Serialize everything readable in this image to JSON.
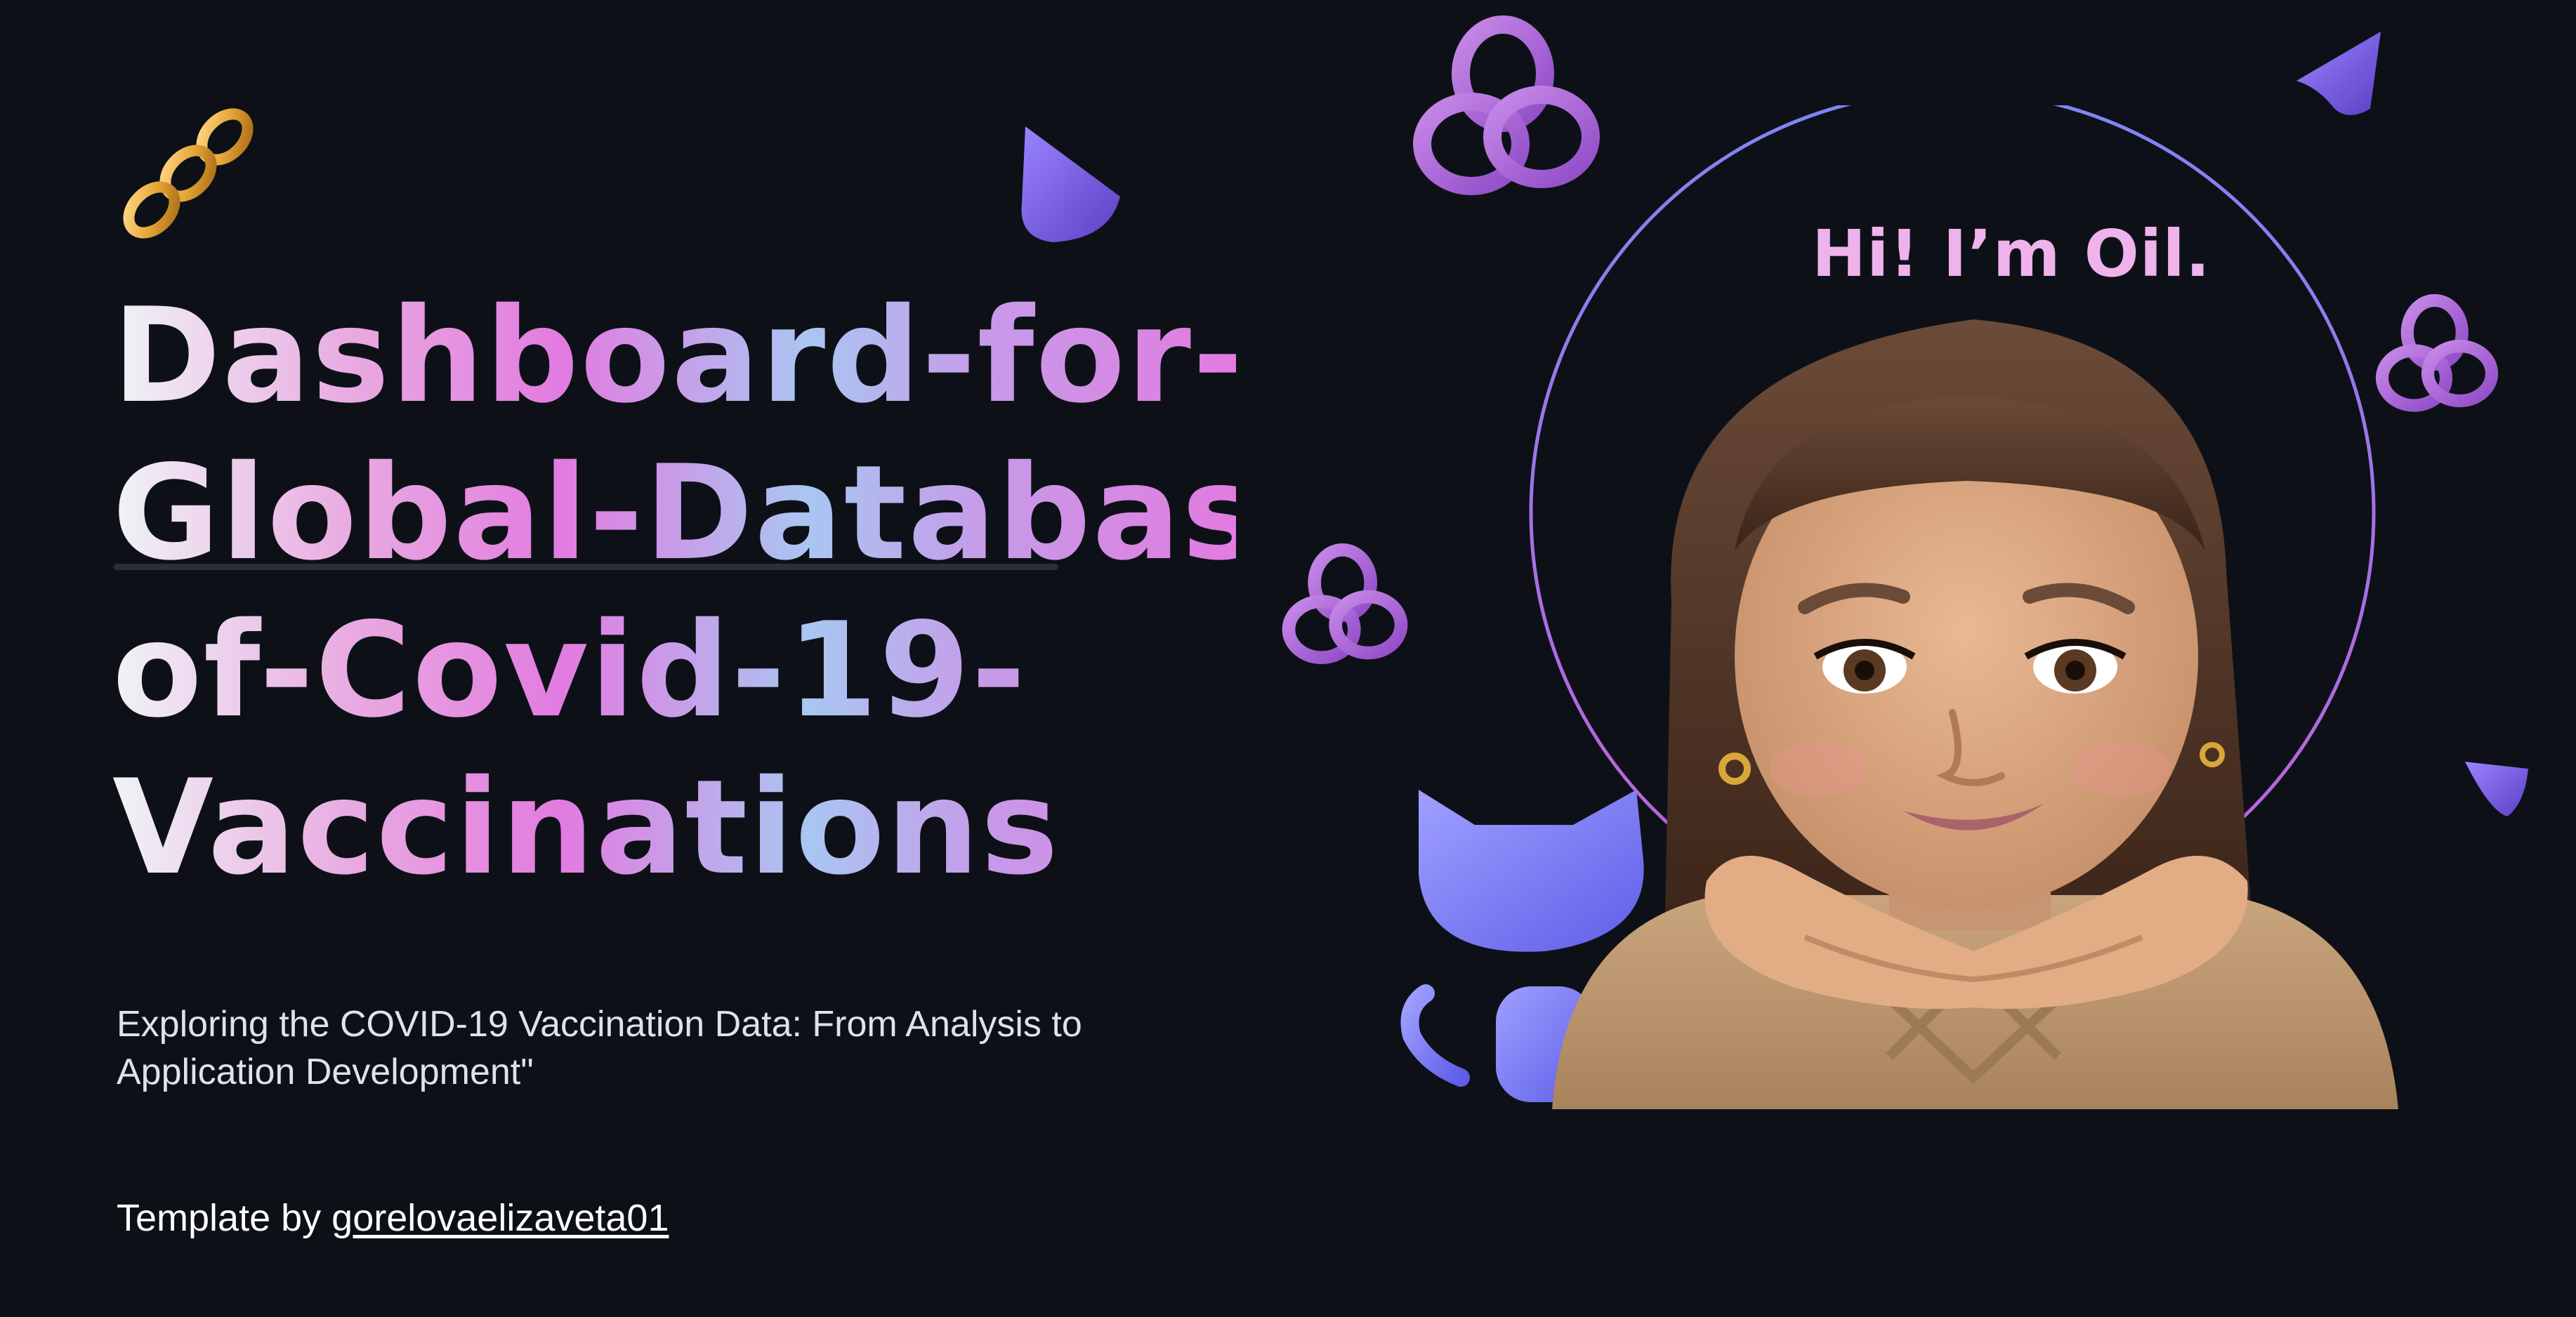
{
  "title_lines": [
    "Dashboard-for-A-",
    "Global-Database-",
    "of-Covid-19-",
    "Vaccinations"
  ],
  "subtitle": "Exploring the COVID-19 Vaccination Data: From Analysis to Application Development\"",
  "credit": {
    "prefix": "Template by ",
    "author": "gorelovaelizaveta01"
  },
  "greeting": "Hi! I’m Oil.",
  "colors": {
    "background": "#0d1117",
    "gradient_pink": "#e27be0",
    "gradient_blue": "#a9c6f2",
    "halo": "#8b7cf0",
    "purple_shape": "#9b5fd6",
    "octocat": "#7b7cff"
  },
  "icons": [
    "chain-icon",
    "cone-icon",
    "knot-icon",
    "octocat-icon",
    "avatar-memoji"
  ]
}
